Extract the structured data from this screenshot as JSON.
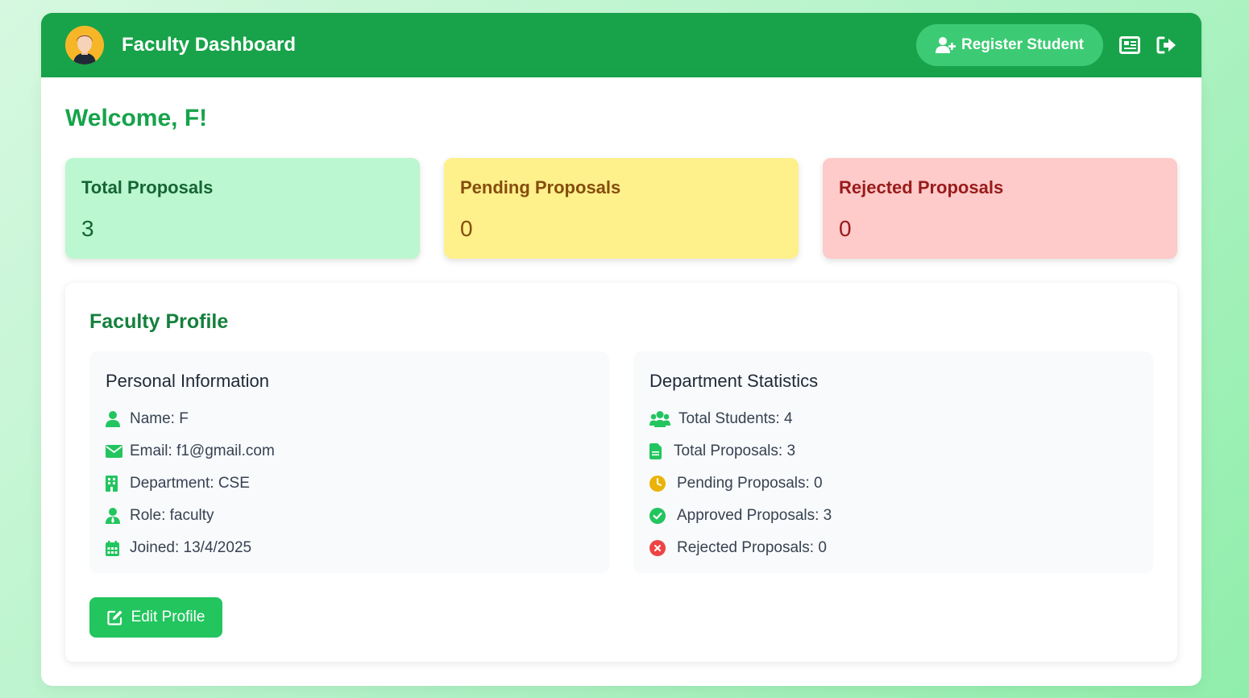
{
  "navbar": {
    "title": "Faculty Dashboard",
    "register_label": "Register Student",
    "icons": [
      "user-avatar",
      "user-plus-icon",
      "newspaper-icon",
      "logout-icon"
    ]
  },
  "welcome": "Welcome, F!",
  "stats": {
    "total": {
      "label": "Total Proposals",
      "value": "3"
    },
    "pending": {
      "label": "Pending Proposals",
      "value": "0"
    },
    "rejected": {
      "label": "Rejected Proposals",
      "value": "0"
    }
  },
  "profile": {
    "title": "Faculty Profile",
    "personal": {
      "title": "Personal Information",
      "name": "Name: F",
      "email": "Email: f1@gmail.com",
      "department": "Department: CSE",
      "role": "Role: faculty",
      "joined": "Joined: 13/4/2025"
    },
    "department": {
      "title": "Department Statistics",
      "students": "Total Students: 4",
      "proposals": "Total Proposals: 3",
      "pending": "Pending Proposals: 0",
      "approved": "Approved Proposals: 3",
      "rejected": "Rejected Proposals: 0"
    },
    "edit_label": "Edit Profile"
  },
  "colors": {
    "primary": "#18a34a",
    "accent_green": "#22c55e",
    "pending_icon": "#eab308",
    "rejected_icon": "#ef4444"
  }
}
